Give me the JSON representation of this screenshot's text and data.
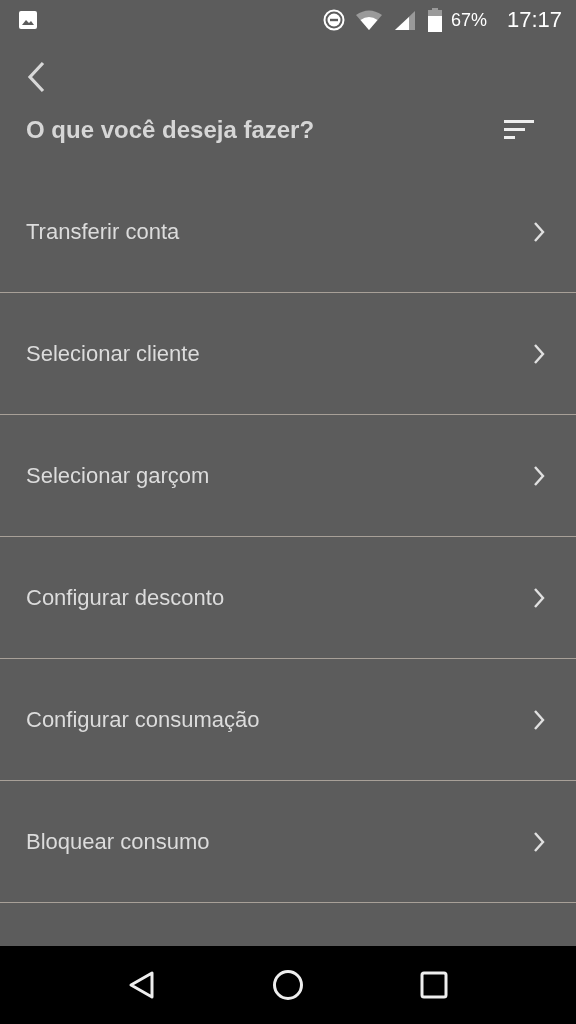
{
  "status_bar": {
    "battery": "67%",
    "time": "17:17"
  },
  "header": {
    "title": "O que você deseja fazer?"
  },
  "items": [
    {
      "label": "Transferir conta"
    },
    {
      "label": "Selecionar cliente"
    },
    {
      "label": "Selecionar garçom"
    },
    {
      "label": "Configurar desconto"
    },
    {
      "label": "Configurar consumação"
    },
    {
      "label": "Bloquear consumo"
    }
  ]
}
